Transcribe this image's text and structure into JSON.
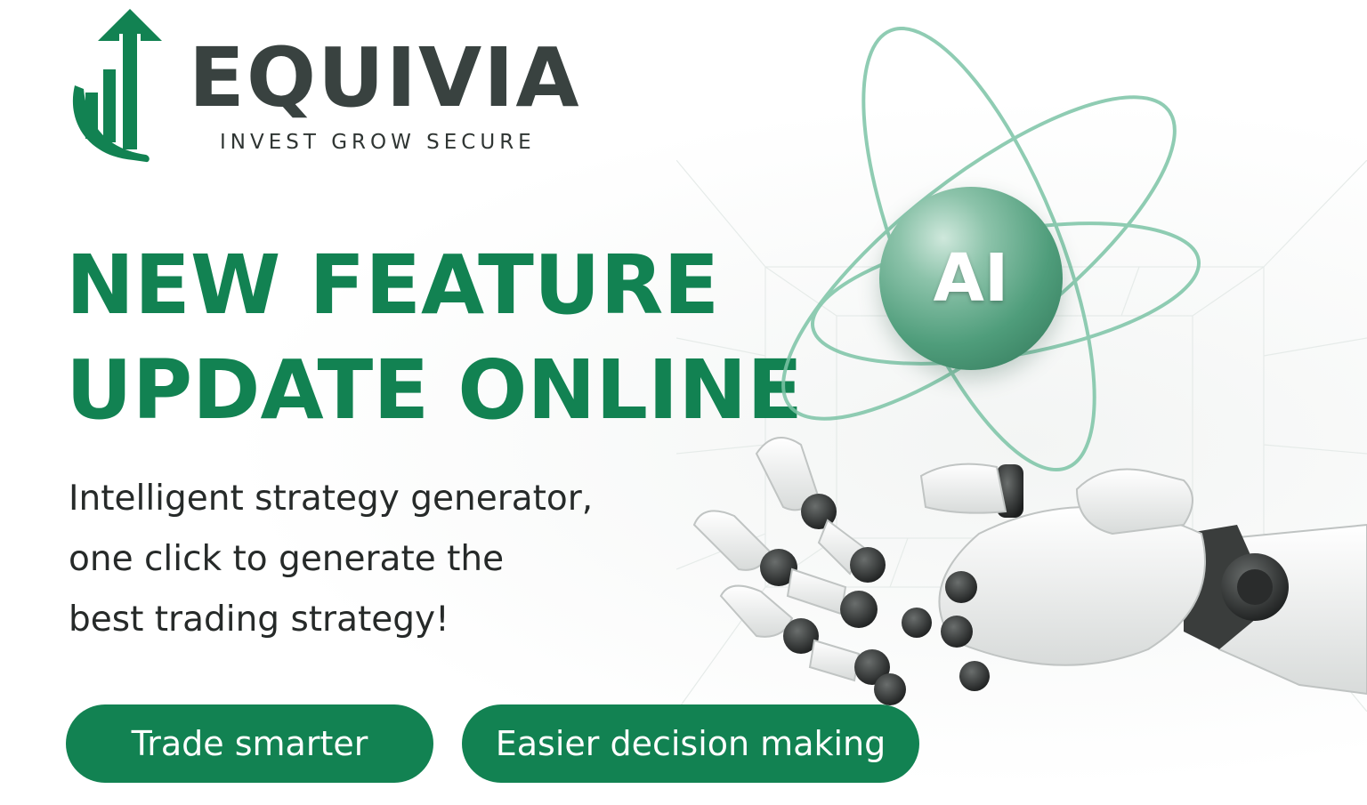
{
  "brand": {
    "name": "EQUIVIA",
    "tagline": "INVEST GROW SECURE"
  },
  "headline": {
    "line1": "NEW FEATURE",
    "line2": "UPDATE ONLINE"
  },
  "description": {
    "line1": "Intelligent strategy generator,",
    "line2": "one click to generate the",
    "line3": "best trading strategy!"
  },
  "badges": {
    "primary": "Trade smarter",
    "secondary": "Easier decision making"
  },
  "orb": {
    "label": "AI"
  },
  "colors": {
    "brand_green": "#128252",
    "dark_gray": "#394240",
    "orbit_green": "#7cc4a6"
  },
  "icons": {
    "logo": "growth-arrow-bars-icon",
    "orbits": "atom-orbit-icon",
    "hand": "robot-hand-illustration"
  }
}
